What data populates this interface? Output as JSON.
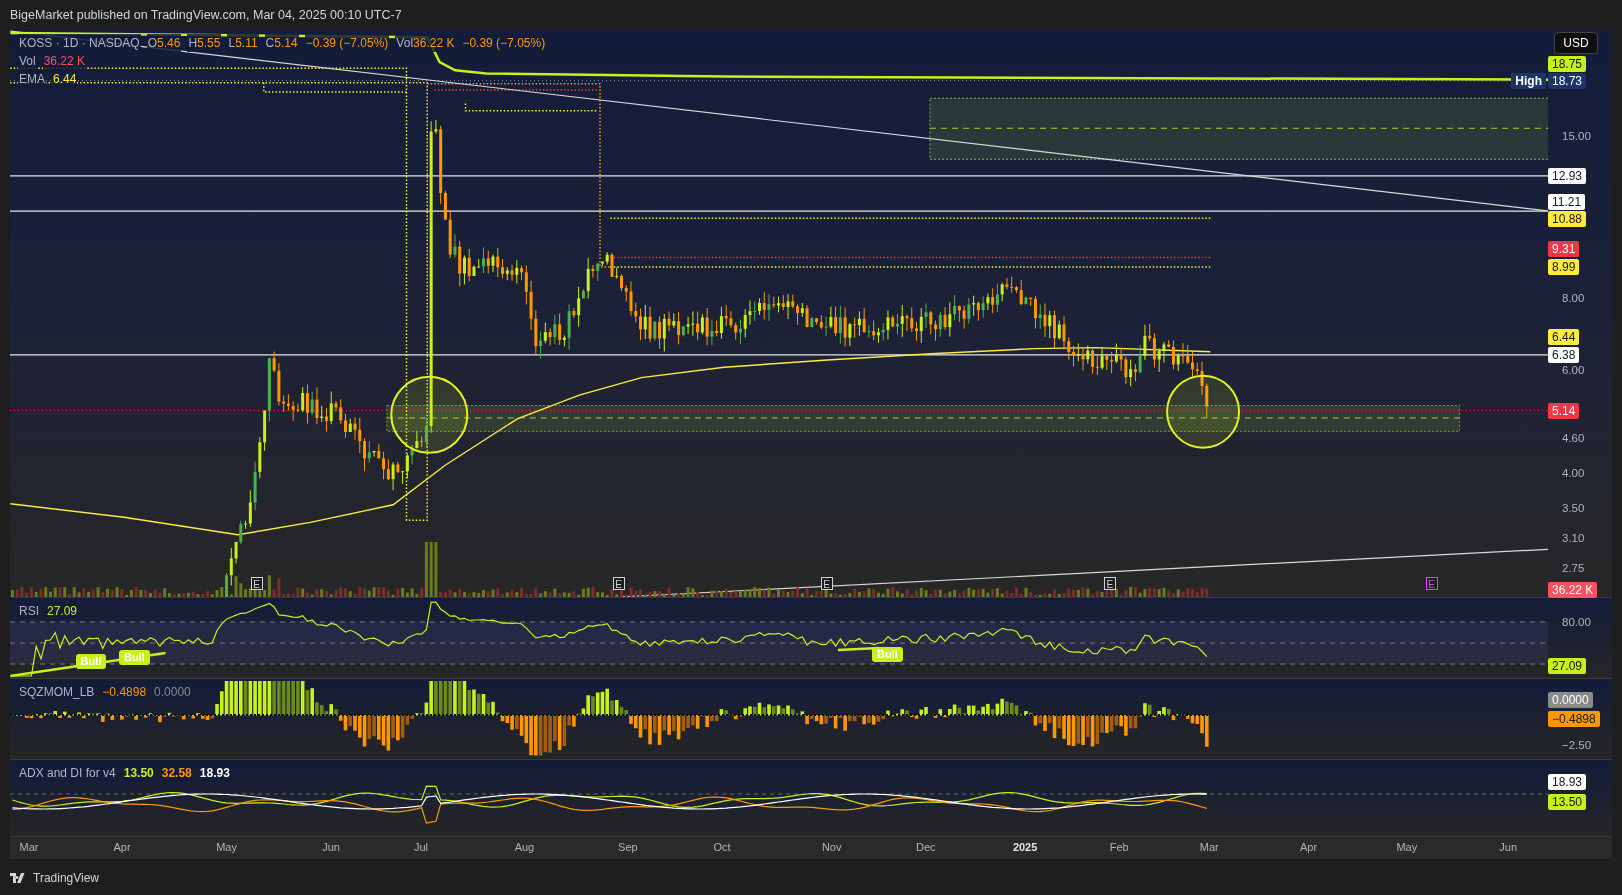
{
  "header": {
    "title": "BigeMarket published on TradingView.com, Mar 04, 2025 00:10 UTC-7"
  },
  "main_pane": {
    "legend": {
      "symbol": "KOSS · 1D · NASDAQ",
      "values": [
        {
          "label": "O",
          "value": "5.46"
        },
        {
          "label": "H",
          "value": "5.55"
        },
        {
          "label": "L",
          "value": "5.11"
        },
        {
          "label": "C",
          "value": "5.14"
        }
      ],
      "change": "−0.39 (−7.05%)",
      "volume_label": "Vol",
      "volume_value": "36.22 K",
      "volume_change": "−0.39 (−7.05%)"
    },
    "studies": [
      {
        "name": "Vol",
        "value": "36.22 K",
        "color": "#f7525f"
      },
      {
        "name": "EMA",
        "value": "6.44",
        "color": "#ffeb3b"
      }
    ],
    "currency_button": "USD",
    "price_ticks": [
      "15.00",
      "8.00",
      "6.00",
      "4.60",
      "4.00",
      "3.50",
      "3.10",
      "2.75"
    ],
    "price_tags": [
      {
        "label": "18.75",
        "color": "#c6f11a"
      },
      {
        "label": "18.73",
        "caption": "High",
        "color": "#1c3566"
      },
      {
        "label": "12.93",
        "color": "#ffffff"
      },
      {
        "label": "11.21",
        "color": "#ffffff"
      },
      {
        "label": "10.88",
        "color": "#ffeb3b"
      },
      {
        "label": "9.31",
        "color": "#f23645"
      },
      {
        "label": "8.99",
        "color": "#ffeb3b"
      },
      {
        "label": "6.44",
        "color": "#ffeb3b"
      },
      {
        "label": "6.38",
        "color": "#ffffff"
      },
      {
        "label": "5.14",
        "color": "#f23645"
      },
      {
        "label": "36.22 K",
        "color": "#f7525f"
      }
    ],
    "event_markers": [
      {
        "label": "E",
        "color": "#d1d4dc"
      },
      {
        "label": "E",
        "color": "#d1d4dc"
      },
      {
        "label": "E",
        "color": "#d1d4dc"
      },
      {
        "label": "E",
        "color": "#d1d4dc"
      },
      {
        "label": "E",
        "color": "#e040fb"
      }
    ]
  },
  "rsi_pane": {
    "title": "RSI",
    "value": "27.09",
    "ticks": [
      "80.00"
    ],
    "tag": "27.09",
    "signals": [
      "Bull",
      "Bull",
      "Bull"
    ]
  },
  "sqz_pane": {
    "title": "SQZMOM_LB",
    "values": [
      {
        "text": "−0.4898",
        "color": "#ff9800"
      },
      {
        "text": "0.0000",
        "color": "#8a8a8a"
      }
    ],
    "ticks": [
      "−2.50"
    ],
    "tags": [
      {
        "label": "0.0000",
        "color": "#8a8a8a"
      },
      {
        "label": "−0.4898",
        "color": "#ff9800"
      }
    ]
  },
  "adx_pane": {
    "title": "ADX and DI for v4",
    "values": [
      {
        "text": "13.50",
        "color": "#c6f11a"
      },
      {
        "text": "32.58",
        "color": "#ff9800"
      },
      {
        "text": "18.93",
        "color": "#ffffff"
      }
    ],
    "tags": [
      {
        "label": "18.93",
        "color": "#ffffff"
      },
      {
        "label": "13.50",
        "color": "#c6f11a"
      }
    ]
  },
  "time_axis": [
    {
      "label": "Mar",
      "bold": false
    },
    {
      "label": "Apr",
      "bold": false
    },
    {
      "label": "May",
      "bold": false
    },
    {
      "label": "Jun",
      "bold": false
    },
    {
      "label": "Jul",
      "bold": false
    },
    {
      "label": "Aug",
      "bold": false
    },
    {
      "label": "Sep",
      "bold": false
    },
    {
      "label": "Oct",
      "bold": false
    },
    {
      "label": "Nov",
      "bold": false
    },
    {
      "label": "Dec",
      "bold": false
    },
    {
      "label": "2025",
      "bold": true
    },
    {
      "label": "Feb",
      "bold": false
    },
    {
      "label": "Mar",
      "bold": false
    },
    {
      "label": "Apr",
      "bold": false
    },
    {
      "label": "May",
      "bold": false
    },
    {
      "label": "Jun",
      "bold": false
    }
  ],
  "footer": {
    "brand": "TradingView"
  }
}
